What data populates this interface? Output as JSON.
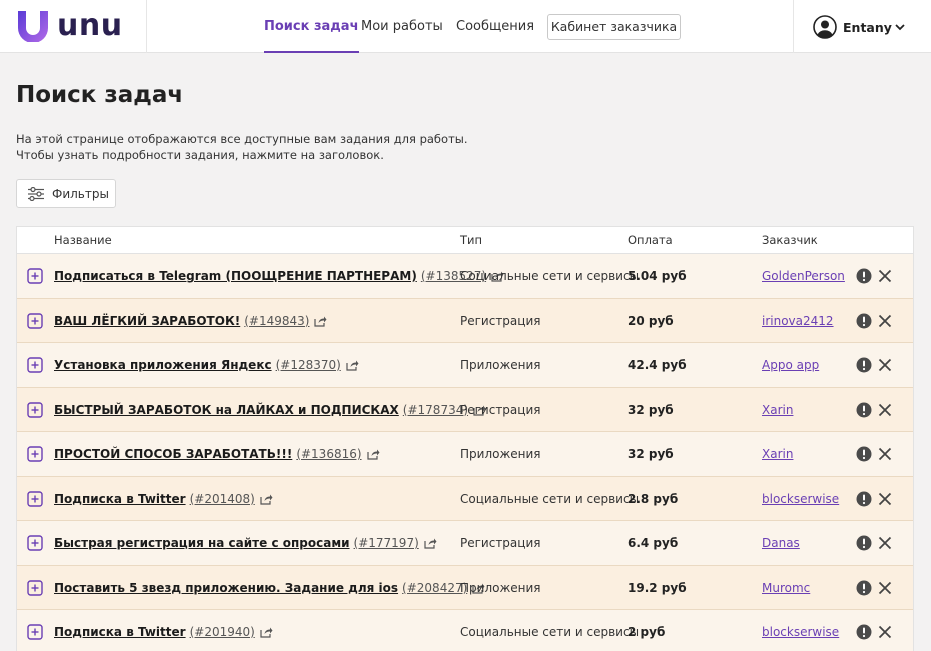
{
  "header": {
    "logo_text": "unu",
    "nav": [
      {
        "label": "Поиск задач",
        "active": true
      },
      {
        "label": "Мои работы",
        "active": false
      },
      {
        "label": "Сообщения",
        "active": false
      }
    ],
    "cabinet_button": "Кабинет заказчика",
    "user_name": "Entany"
  },
  "page": {
    "title": "Поиск задач",
    "desc_line1": "На этой странице отображаются все доступные вам задания для работы.",
    "desc_line2": "Чтобы узнать подробности задания, нажмите на заголовок.",
    "filter_label": "Фильтры"
  },
  "table": {
    "columns": {
      "name": "Название",
      "type": "Тип",
      "pay": "Оплата",
      "customer": "Заказчик"
    },
    "rows": [
      {
        "title": "Подписаться в Telegram (ПООЩРЕНИЕ ПАРТНЕРАМ)",
        "id": "(#138527)",
        "type": "Социальные сети и сервисы",
        "pay": "5.04 руб",
        "customer": "GoldenPerson"
      },
      {
        "title": "ВАШ ЛЁГКИЙ ЗАРАБОТОК!",
        "id": "(#149843)",
        "type": "Регистрация",
        "pay": "20 руб",
        "customer": "irinova2412"
      },
      {
        "title": "Установка приложения Яндекс",
        "id": "(#128370)",
        "type": "Приложения",
        "pay": "42.4 руб",
        "customer": "Appo app"
      },
      {
        "title": "БЫСТРЫЙ ЗАРАБОТОК на ЛАЙКАХ и ПОДПИСКАХ",
        "id": "(#178734)",
        "type": "Регистрация",
        "pay": "32 руб",
        "customer": "Xarin"
      },
      {
        "title": "ПРОСТОЙ СПОСОБ ЗАРАБОТАТЬ!!!",
        "id": "(#136816)",
        "type": "Приложения",
        "pay": "32 руб",
        "customer": "Xarin"
      },
      {
        "title": "Подписка в Twitter",
        "id": "(#201408)",
        "type": "Социальные сети и сервисы",
        "pay": "2.8 руб",
        "customer": "blockserwise"
      },
      {
        "title": "Быстрая регистрация на сайте с опросами",
        "id": "(#177197)",
        "type": "Регистрация",
        "pay": "6.4 руб",
        "customer": "Danas"
      },
      {
        "title": "Поставить 5 звезд приложению. Задание для ios",
        "id": "(#208427)",
        "type": "Приложения",
        "pay": "19.2 руб",
        "customer": "Muromc"
      },
      {
        "title": "Подписка в Twitter",
        "id": "(#201940)",
        "type": "Социальные сети и сервисы",
        "pay": "2 руб",
        "customer": "blockserwise"
      }
    ]
  },
  "colors": {
    "accent": "#6a3fb4",
    "row_odd": "#fbefe0",
    "row_even": "#fbf4eb",
    "logo_gradient": [
      "#5a3bd6",
      "#b36be8"
    ]
  },
  "icons": [
    "logo-mark-icon",
    "user-avatar-icon",
    "chevron-down-icon",
    "filter-sliders-icon",
    "expand-plus-icon",
    "share-icon",
    "alert-icon",
    "close-icon"
  ]
}
